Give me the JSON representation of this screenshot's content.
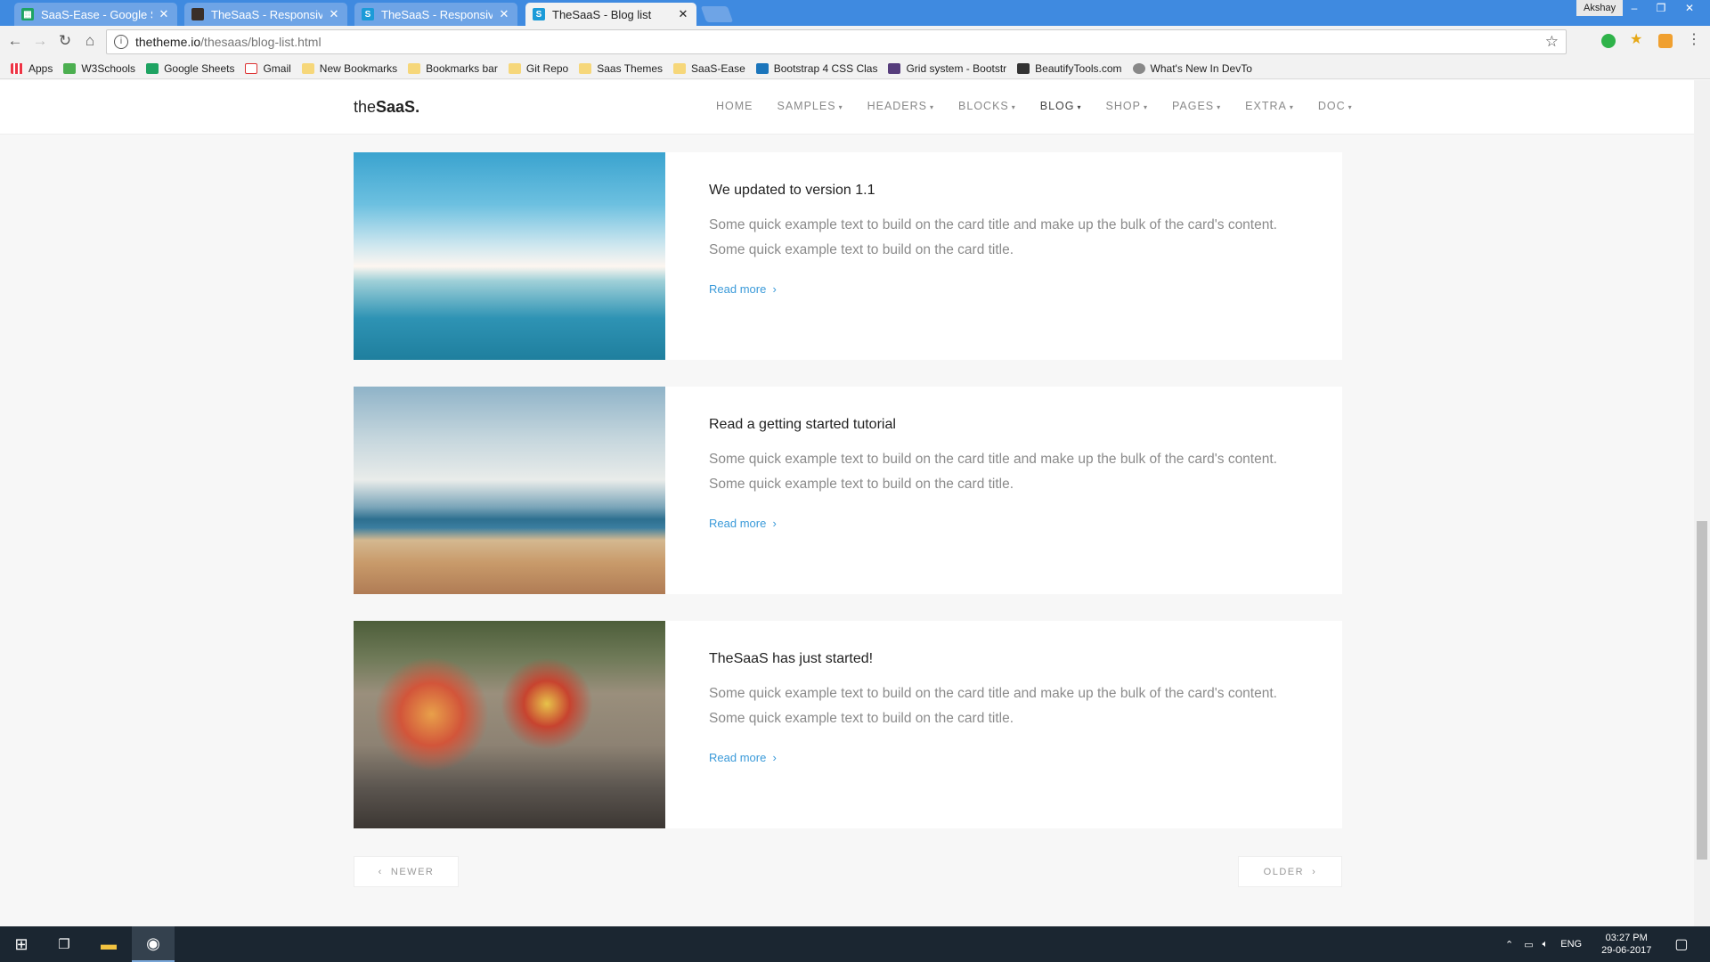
{
  "browser": {
    "tabs": [
      {
        "title": "SaaS-Ease - Google Sheets",
        "favicon": "sheets-icon",
        "active": false
      },
      {
        "title": "TheSaaS - Responsive Bootstrap",
        "favicon": "thesaas-dark-icon",
        "active": false
      },
      {
        "title": "TheSaaS - Responsive Bootstrap",
        "favicon": "thesaas-icon",
        "active": false
      },
      {
        "title": "TheSaaS - Blog list",
        "favicon": "thesaas-icon",
        "active": true
      }
    ],
    "user": "Akshay",
    "url_host": "thetheme.io",
    "url_path": "/thesaas/blog-list.html",
    "bookmarks": [
      {
        "label": "Apps",
        "icon": "apps-grid-icon"
      },
      {
        "label": "W3Schools",
        "icon": "w3schools-icon"
      },
      {
        "label": "Google Sheets",
        "icon": "sheets-icon"
      },
      {
        "label": "Gmail",
        "icon": "gmail-icon"
      },
      {
        "label": "New Bookmarks",
        "icon": "folder-icon"
      },
      {
        "label": "Bookmarks bar",
        "icon": "folder-icon"
      },
      {
        "label": "Git Repo",
        "icon": "folder-icon"
      },
      {
        "label": "Saas Themes",
        "icon": "folder-icon"
      },
      {
        "label": "SaaS-Ease",
        "icon": "folder-icon"
      },
      {
        "label": "Bootstrap 4 CSS Clas",
        "icon": "bootstrap-icon"
      },
      {
        "label": "Grid system - Bootstr",
        "icon": "bootstrap-b-icon"
      },
      {
        "label": "BeautifyTools.com",
        "icon": "beautify-icon"
      },
      {
        "label": "What's New In DevTo",
        "icon": "devtools-icon"
      }
    ]
  },
  "site": {
    "logo_light": "the",
    "logo_bold": "SaaS.",
    "menu": [
      {
        "label": "HOME",
        "caret": false,
        "active": false
      },
      {
        "label": "SAMPLES",
        "caret": true,
        "active": false
      },
      {
        "label": "HEADERS",
        "caret": true,
        "active": false
      },
      {
        "label": "BLOCKS",
        "caret": true,
        "active": false
      },
      {
        "label": "BLOG",
        "caret": true,
        "active": true
      },
      {
        "label": "SHOP",
        "caret": true,
        "active": false
      },
      {
        "label": "PAGES",
        "caret": true,
        "active": false
      },
      {
        "label": "EXTRA",
        "caret": true,
        "active": false
      },
      {
        "label": "DOC",
        "caret": true,
        "active": false
      }
    ],
    "posts": [
      {
        "title": "We updated to version 1.1",
        "text": "Some quick example text to build on the card title and make up the bulk of the card's content. Some quick example text to build on the card title.",
        "read_more": "Read more",
        "image": "ocean-horizon-photo"
      },
      {
        "title": "Read a getting started tutorial",
        "text": "Some quick example text to build on the card title and make up the bulk of the card's content. Some quick example text to build on the card title.",
        "read_more": "Read more",
        "image": "crowded-beach-photo"
      },
      {
        "title": "TheSaaS has just started!",
        "text": "Some quick example text to build on the card title and make up the bulk of the card's content. Some quick example text to build on the card title.",
        "read_more": "Read more",
        "image": "street-painter-photo"
      }
    ],
    "pager": {
      "newer": "NEWER",
      "older": "OLDER"
    }
  },
  "taskbar": {
    "language": "ENG",
    "time": "03:27 PM",
    "date": "29-06-2017"
  },
  "colors": {
    "tabstrip": "#3f8ae0",
    "link": "#3a9ad9",
    "page_bg": "#f7f7f7"
  }
}
